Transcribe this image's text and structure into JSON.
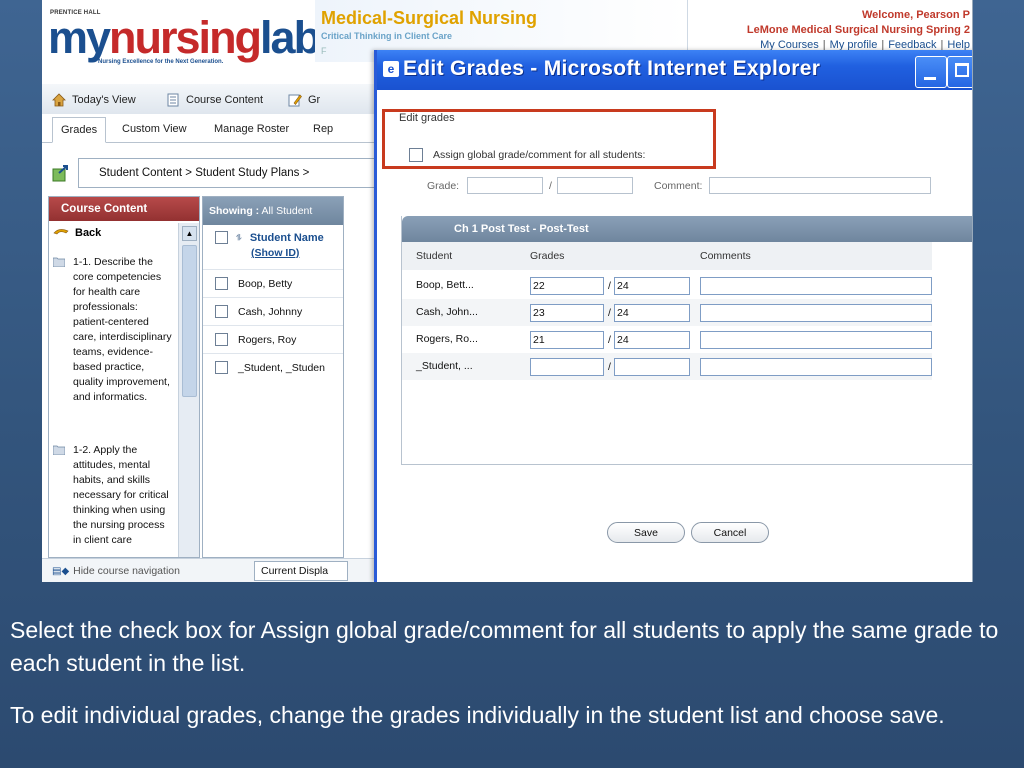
{
  "app": {
    "logo": {
      "publisher": "PRENTICE HALL",
      "my": "my",
      "nursing": "nursing",
      "lab": "lab",
      "tagline": "Nursing Excellence for the Next Generation."
    },
    "book": {
      "title": "Medical-Surgical Nursing",
      "subtitle": "Critical Thinking in Client Care",
      "subtitle2": "F"
    },
    "welcome": "Welcome, Pearson P",
    "course_name": "LeMone Medical Surgical Nursing Spring 2",
    "top_links": [
      "My Courses",
      "My profile",
      "Feedback",
      "Help"
    ],
    "nav": [
      {
        "label": "Today's View",
        "icon": "home-icon"
      },
      {
        "label": "Course Content",
        "icon": "page-icon"
      },
      {
        "label": "Gr",
        "icon": "gradebook-icon"
      }
    ],
    "subtabs": [
      "Grades",
      "Custom View",
      "Manage Roster",
      "Rep"
    ],
    "breadcrumb": "Student Content > Student Study Plans >",
    "course_content": {
      "header": "Course Content",
      "back": "Back",
      "items": [
        "1-1. Describe the core competencies for health care professionals: patient-centered care, interdisciplinary teams, evidence-based practice, quality improvement, and informatics.",
        "1-2. Apply the attitudes, mental habits, and skills necessary for critical thinking when using the nursing process in client care"
      ]
    },
    "showing": {
      "label": "Showing :",
      "value": "All Student",
      "col_header": "Student Name",
      "show_id": "(Show ID)",
      "students": [
        "Boop, Betty",
        "Cash, Johnny",
        "Rogers, Roy",
        "_Student, _Studen"
      ]
    },
    "bottom": {
      "hide_nav": "Hide course navigation",
      "current_display": "Current Displa"
    }
  },
  "popup": {
    "title": "Edit Grades - Microsoft Internet Explorer",
    "section_label": "Edit grades",
    "global_checkbox_label": "Assign global grade/comment for all students:",
    "grade_label": "Grade:",
    "slash": "/",
    "comment_label": "Comment:",
    "table": {
      "title": "Ch 1 Post Test - Post-Test",
      "columns": [
        "Student",
        "Grades",
        "Comments"
      ],
      "rows": [
        {
          "student": "Boop, Bett...",
          "grade": "22",
          "max": "24",
          "comment": ""
        },
        {
          "student": "Cash, John...",
          "grade": "23",
          "max": "24",
          "comment": ""
        },
        {
          "student": "Rogers, Ro...",
          "grade": "21",
          "max": "24",
          "comment": ""
        },
        {
          "student": "_Student, ...",
          "grade": "",
          "max": "",
          "comment": ""
        }
      ]
    },
    "save_label": "Save",
    "cancel_label": "Cancel"
  },
  "caption": {
    "line1": "Select the check box for Assign global grade/comment for all students to apply the same grade to each student in the list.",
    "line2": "To edit individual grades, change the grades individually in the student list and choose save."
  },
  "colors": {
    "highlight": "#c83a1e",
    "titlebar": "#2060e0",
    "slide_bg": "#3f6592",
    "course_header": "#b74a4a"
  }
}
